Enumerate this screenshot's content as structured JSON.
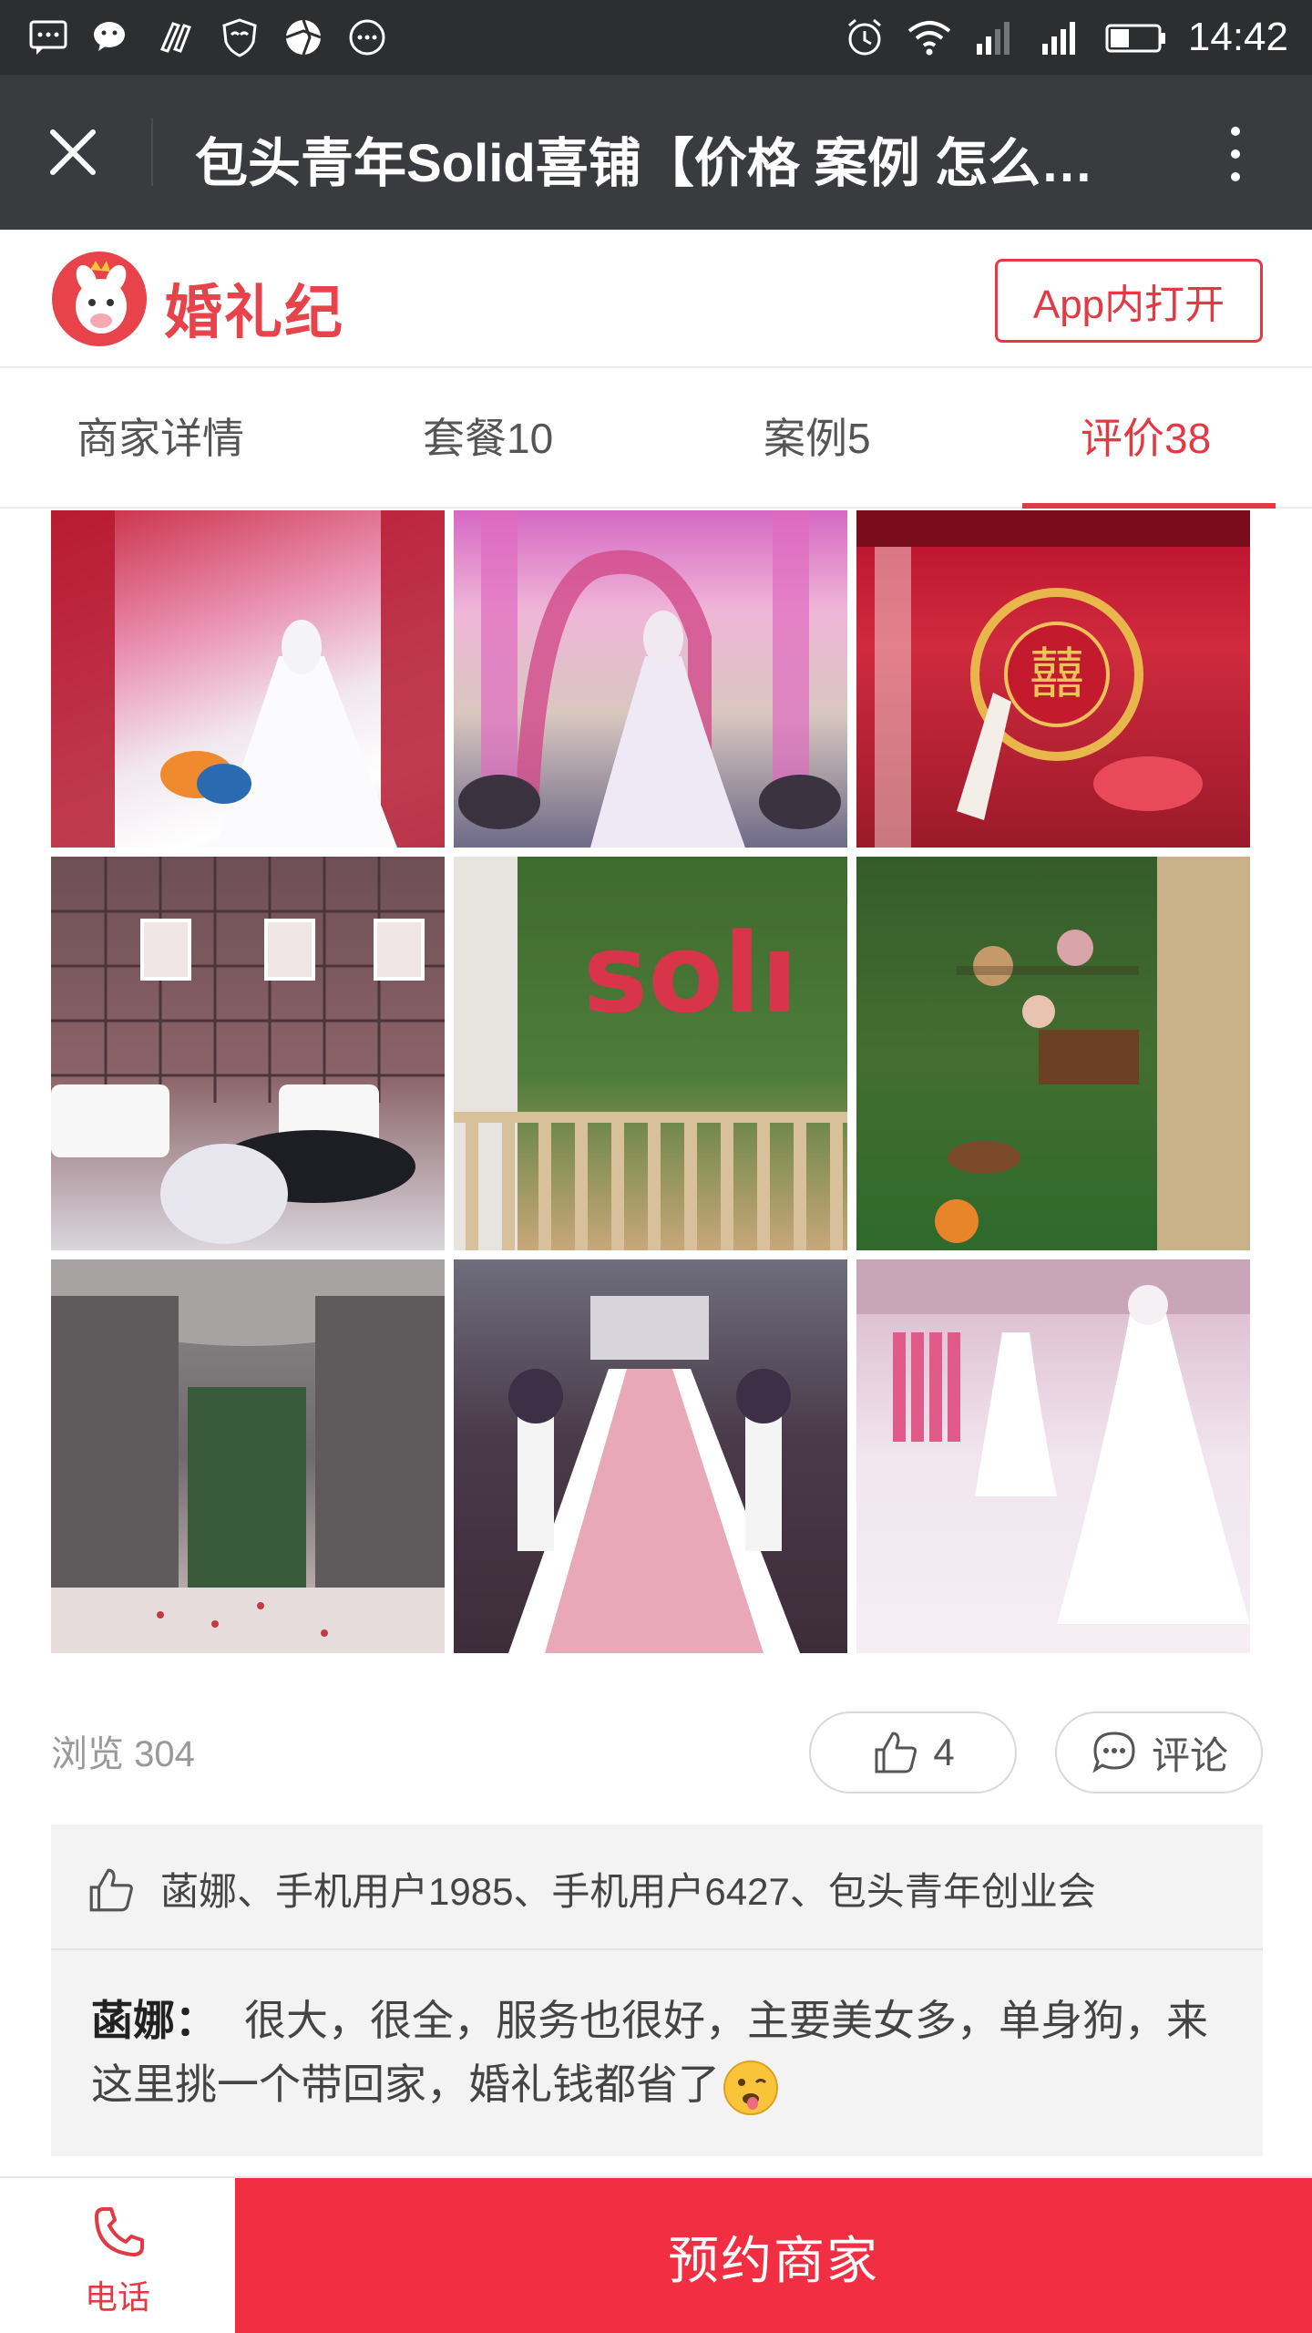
{
  "status_bar": {
    "time": "14:42",
    "left_icons": [
      "message-icon",
      "wechat-icon",
      "poker-icon",
      "shield-icon",
      "aperture-icon",
      "more-dots-icon"
    ],
    "right_icons": [
      "alarm-icon",
      "wifi-icon",
      "signal-icon",
      "signal-icon",
      "battery-icon"
    ]
  },
  "title_bar": {
    "title": "包头青年Solid喜铺【价格 案例 怎么…"
  },
  "brand": {
    "name": "婚礼纪",
    "open_in_app": "App内打开",
    "color": "#e8434a"
  },
  "tabs": [
    {
      "label": "商家详情"
    },
    {
      "label": "套餐10"
    },
    {
      "label": "案例5"
    },
    {
      "label": "评价38",
      "active": true
    }
  ],
  "gallery": {
    "photos": [
      {
        "name": "photo-1",
        "desc": "wedding-dress-red-roses"
      },
      {
        "name": "photo-2",
        "desc": "wedding-dress-pink-arch"
      },
      {
        "name": "photo-3",
        "desc": "chinese-red-room"
      },
      {
        "name": "photo-4",
        "desc": "lounge-with-photos"
      },
      {
        "name": "photo-5",
        "desc": "solid-green-wall"
      },
      {
        "name": "photo-6",
        "desc": "garden-corner"
      },
      {
        "name": "photo-7",
        "desc": "grey-curtains-room"
      },
      {
        "name": "photo-8",
        "desc": "aisle-white-flowers"
      },
      {
        "name": "photo-9",
        "desc": "gown-display-room"
      }
    ]
  },
  "meta": {
    "views": "浏览 304",
    "like_count": "4",
    "comment_label": "评论"
  },
  "likes": {
    "names": "菡娜、手机用户1985、手机用户6427、包头青年创业会"
  },
  "comment": {
    "author": "菡娜：",
    "text": "很大，很全，服务也很好，主要美女多，单身狗，来这里挑一个带回家，婚礼钱都省了"
  },
  "bottom_bar": {
    "phone_label": "电话",
    "book_label": "预约商家",
    "accent": "#f22e42"
  }
}
